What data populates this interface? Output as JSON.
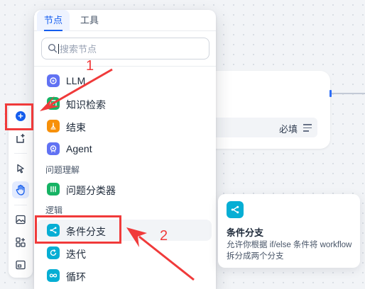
{
  "canvas": {
    "required_label": "必填"
  },
  "toolbar": {
    "buttons": [
      {
        "icon": "add-node-icon",
        "active": false
      },
      {
        "icon": "add-note-icon",
        "active": false
      },
      {
        "icon": "pointer-icon",
        "active": false
      },
      {
        "icon": "hand-icon",
        "active": true
      },
      {
        "icon": "export-image-icon",
        "active": false
      },
      {
        "icon": "organize-blocks-icon",
        "active": false
      },
      {
        "icon": "minimap-icon",
        "active": false
      }
    ]
  },
  "popup": {
    "tabs": [
      {
        "label": "节点",
        "active": true
      },
      {
        "label": "工具",
        "active": false
      }
    ],
    "search": {
      "placeholder": "搜索节点",
      "value": ""
    },
    "items_top": [
      {
        "label": "LLM",
        "icon": "llm-icon",
        "color": "#6172f3"
      },
      {
        "label": "知识检索",
        "icon": "knowledge-retrieval-icon",
        "color": "#16b364"
      },
      {
        "label": "结束",
        "icon": "end-icon",
        "color": "#f79009"
      },
      {
        "label": "Agent",
        "icon": "agent-icon",
        "color": "#6172f3"
      }
    ],
    "section_understanding": "问题理解",
    "item_classifier": {
      "label": "问题分类器",
      "icon": "question-classifier-icon",
      "color": "#16b364"
    },
    "section_logic": "逻辑",
    "items_logic": [
      {
        "label": "条件分支",
        "icon": "if-else-icon",
        "color": "#06aed4",
        "hover": true
      },
      {
        "label": "迭代",
        "icon": "iteration-icon",
        "color": "#06aed4"
      },
      {
        "label": "循环",
        "icon": "loop-icon",
        "color": "#06aed4"
      }
    ]
  },
  "tooltip": {
    "title": "条件分支",
    "description": "允许你根据 if/else 条件将 workflow 拆分成两个分支",
    "icon": "if-else-icon",
    "color": "#06aed4"
  },
  "annotations": {
    "step1": "1",
    "step2": "2",
    "color": "#f03a3a"
  }
}
